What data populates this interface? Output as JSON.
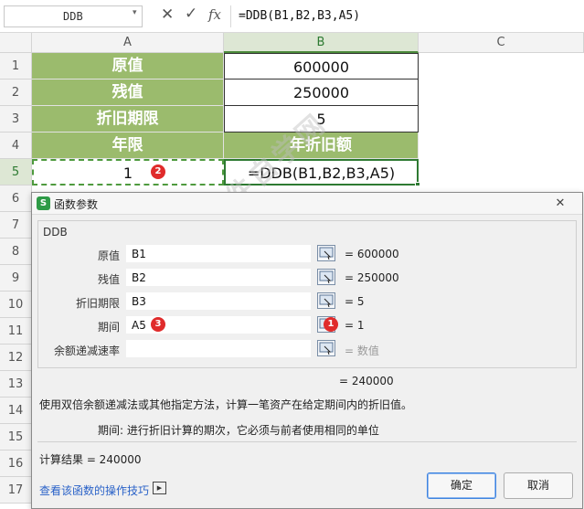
{
  "formula_bar": {
    "name_box": "DDB",
    "cancel_icon": "✕",
    "enter_icon": "✓",
    "fx_label": "fx",
    "formula": "=DDB(B1,B2,B3,A5)"
  },
  "columns": [
    "A",
    "B",
    "C"
  ],
  "rows": [
    "1",
    "2",
    "3",
    "4",
    "5",
    "6",
    "7",
    "8",
    "9",
    "10",
    "11",
    "12",
    "13",
    "14",
    "15",
    "16",
    "17"
  ],
  "cells": [
    {
      "a": "原值",
      "b": "600000"
    },
    {
      "a": "残值",
      "b": "250000"
    },
    {
      "a": "折旧期限",
      "b": "5"
    },
    {
      "a": "年限",
      "b": "年折旧额"
    },
    {
      "a": "1",
      "b": "=DDB(B1,B2,B3,A5)"
    }
  ],
  "badges": {
    "cell": "2",
    "arg": "3",
    "picker": "1"
  },
  "dialog": {
    "title": "函数参数",
    "logo": "S",
    "close": "✕",
    "function_name": "DDB",
    "args": [
      {
        "label": "原值",
        "value": "B1",
        "result": "= 600000"
      },
      {
        "label": "残值",
        "value": "B2",
        "result": "= 250000"
      },
      {
        "label": "折旧期限",
        "value": "B3",
        "result": "= 5"
      },
      {
        "label": "期间",
        "value": "A5",
        "result": "= 1"
      },
      {
        "label": "余额递减速率",
        "value": "",
        "result": "= 数值"
      }
    ],
    "function_result": "= 240000",
    "description": "使用双倍余额递减法或其他指定方法，计算一笔资产在给定期间内的折旧值。",
    "param_description": "期间:  进行折旧计算的期次，它必须与前者使用相同的单位",
    "calc_result": "计算结果 =  240000",
    "help_link": "查看该函数的操作技巧",
    "ok": "确定",
    "cancel": "取消"
  },
  "watermark": "软件自学网",
  "colors": {
    "header_green": "#9bbb6d",
    "badge_red": "#e02b2b",
    "accent_blue": "#3e84e0"
  }
}
